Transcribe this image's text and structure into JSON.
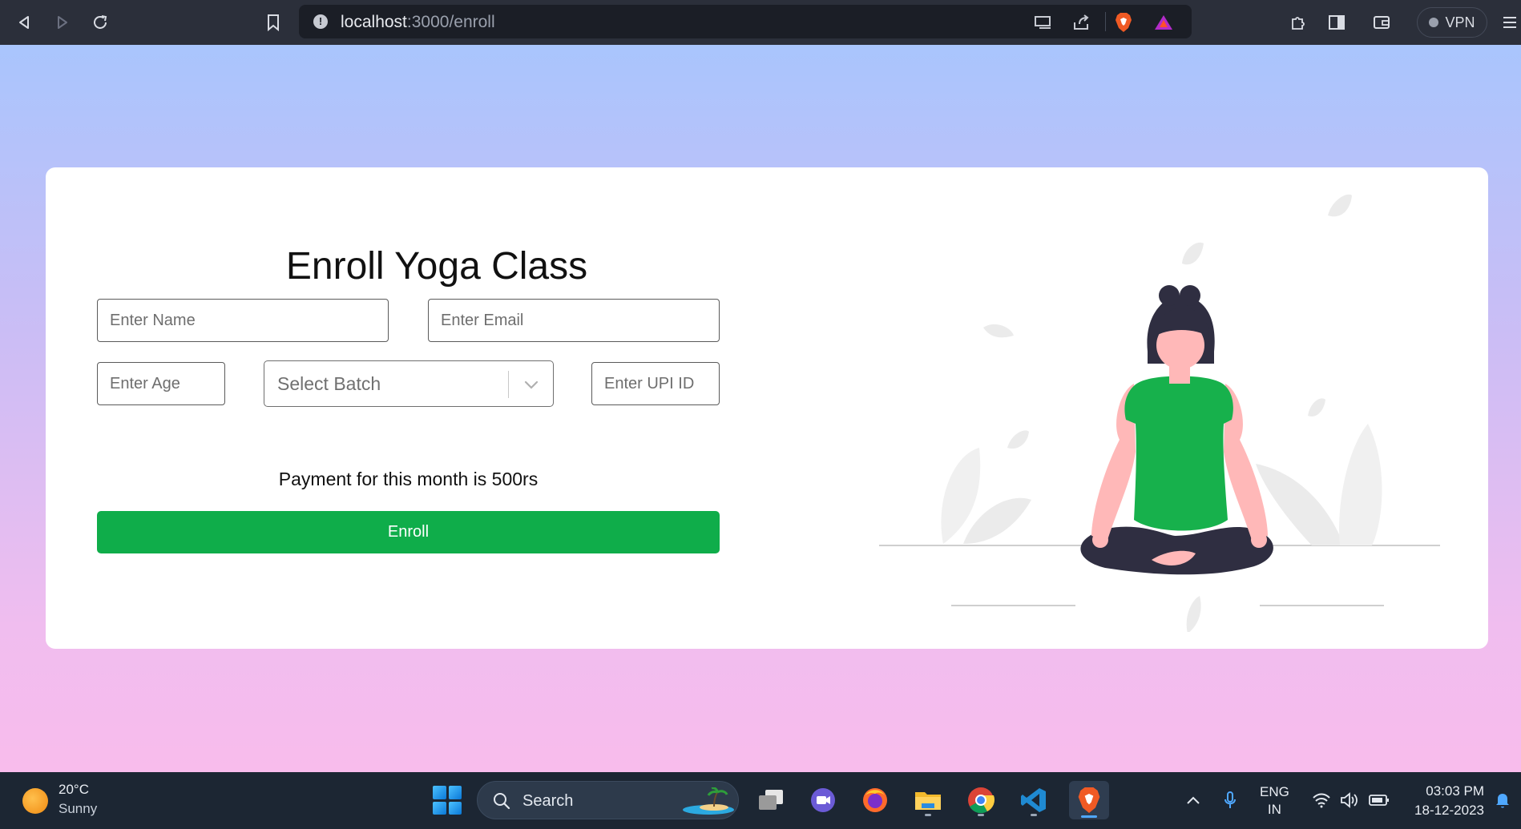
{
  "browser": {
    "url_host": "localhost",
    "url_path": ":3000/enroll",
    "vpn_label": "VPN"
  },
  "form": {
    "title": "Enroll Yoga Class",
    "name_placeholder": "Enter Name",
    "email_placeholder": "Enter Email",
    "age_placeholder": "Enter Age",
    "batch_placeholder": "Select Batch",
    "upi_placeholder": "Enter UPI ID",
    "payment_text": "Payment for this month is 500rs",
    "enroll_label": "Enroll"
  },
  "colors": {
    "accent_green": "#0fad4a",
    "illustration_shirt": "#17b14c",
    "illustration_skin": "#ffb8b8",
    "illustration_dark": "#2f2e41"
  },
  "taskbar": {
    "weather_temp": "20°C",
    "weather_desc": "Sunny",
    "search_label": "Search",
    "lang_line1": "ENG",
    "lang_line2": "IN",
    "time": "03:03 PM",
    "date": "18-12-2023",
    "apps": [
      "task-view",
      "teams-meet",
      "firefox",
      "file-explorer",
      "chrome",
      "vscode",
      "brave"
    ]
  }
}
